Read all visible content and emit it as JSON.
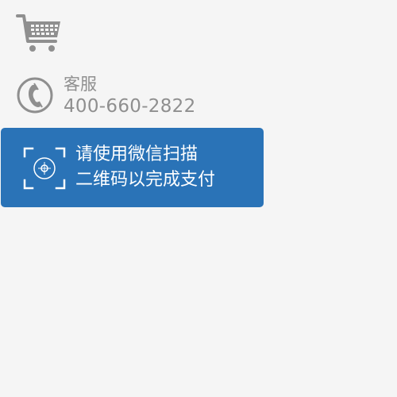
{
  "service": {
    "label": "客服",
    "phone": "400-660-2822"
  },
  "scan_prompt": {
    "line1": "请使用微信扫描",
    "line2": "二维码以完成支付"
  },
  "colors": {
    "background": "#f5f5f5",
    "icon_gray": "#8f8f8f",
    "accent_blue": "#2a73b7",
    "text_white": "#ffffff"
  },
  "icons": {
    "cart": "shopping-cart-icon",
    "phone": "phone-icon",
    "scan": "qr-scan-icon"
  }
}
